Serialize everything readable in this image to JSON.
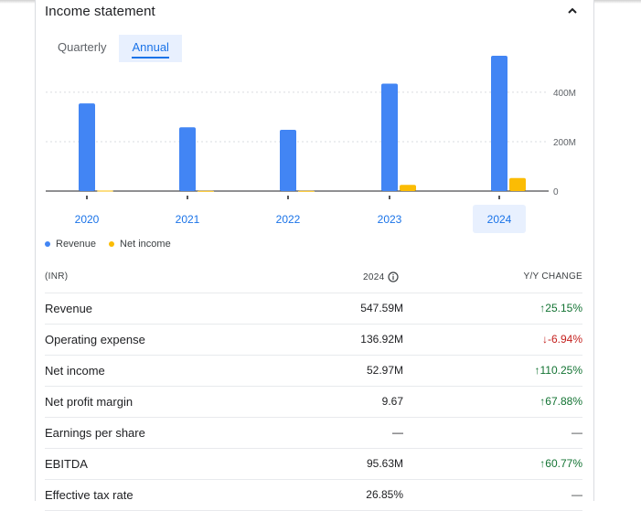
{
  "header": {
    "title": "Income statement",
    "collapse_icon": "chevron-up-icon"
  },
  "tabs": [
    {
      "label": "Quarterly",
      "active": false
    },
    {
      "label": "Annual",
      "active": true
    }
  ],
  "chart_data": {
    "type": "bar",
    "categories": [
      "2020",
      "2021",
      "2022",
      "2023",
      "2024"
    ],
    "selected_category": "2024",
    "series": [
      {
        "name": "Revenue",
        "color": "#4285f4",
        "values": [
          355,
          258,
          248,
          435,
          547.59
        ]
      },
      {
        "name": "Net income",
        "color": "#fbbc04",
        "values": [
          2,
          1,
          1,
          25,
          52.97
        ]
      }
    ],
    "y_ticks": [
      {
        "value": 0,
        "label": "0"
      },
      {
        "value": 200,
        "label": "200M"
      },
      {
        "value": 400,
        "label": "400M"
      }
    ],
    "ylim": [
      0,
      570
    ],
    "legend_position": "bottom-left"
  },
  "table": {
    "headers": {
      "metric": "(INR)",
      "year": "2024",
      "change": "Y/Y CHANGE"
    },
    "info_icon": "info-icon",
    "rows": [
      {
        "label": "Revenue",
        "value": "547.59M",
        "change": "25.15%",
        "direction": "up"
      },
      {
        "label": "Operating expense",
        "value": "136.92M",
        "change": "-6.94%",
        "direction": "down"
      },
      {
        "label": "Net income",
        "value": "52.97M",
        "change": "110.25%",
        "direction": "up"
      },
      {
        "label": "Net profit margin",
        "value": "9.67",
        "change": "67.88%",
        "direction": "up"
      },
      {
        "label": "Earnings per share",
        "value": "—",
        "change": "—",
        "direction": "none"
      },
      {
        "label": "EBITDA",
        "value": "95.63M",
        "change": "60.77%",
        "direction": "up"
      },
      {
        "label": "Effective tax rate",
        "value": "26.85%",
        "change": "—",
        "direction": "none"
      }
    ]
  }
}
